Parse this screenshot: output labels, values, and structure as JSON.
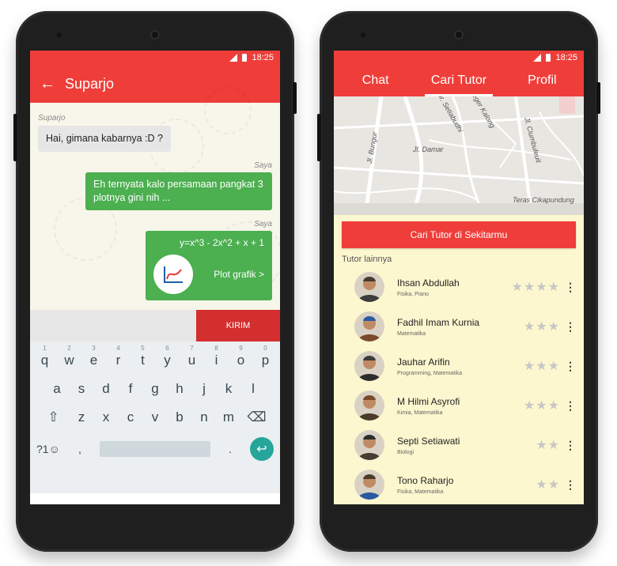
{
  "status": {
    "time": "18:25"
  },
  "chat": {
    "contact_name": "Suparjo",
    "back_icon": "arrow-left-icon",
    "messages": [
      {
        "sender": "Suparjo",
        "text": "Hai, gimana kabarnya :D ?",
        "side": "in"
      },
      {
        "sender": "Saya",
        "text": "Eh ternyata kalo persamaan pangkat 3 plotnya gini nih ...",
        "side": "out"
      },
      {
        "sender": "Saya",
        "equation": "y=x^3 - 2x^2 + x + 1",
        "action": "Plot grafik >",
        "side": "out"
      }
    ],
    "send_label": "KIRIM"
  },
  "keyboard": {
    "row1": [
      "q",
      "w",
      "e",
      "r",
      "t",
      "y",
      "u",
      "i",
      "o",
      "p"
    ],
    "row1_nums": [
      "1",
      "2",
      "3",
      "4",
      "5",
      "6",
      "7",
      "8",
      "9",
      "0"
    ],
    "row2": [
      "a",
      "s",
      "d",
      "f",
      "g",
      "h",
      "j",
      "k",
      "l"
    ],
    "row3": [
      "z",
      "x",
      "c",
      "v",
      "b",
      "n",
      "m"
    ],
    "symbols_label": "?1☺",
    "comma": ",",
    "period": "."
  },
  "tutor_app": {
    "tabs": [
      "Chat",
      "Cari Tutor",
      "Profil"
    ],
    "active_tab": 1,
    "map_labels": [
      "Jl. Dr. Setiabudhi",
      "Jl. Damar",
      "Jl. Bungur",
      "Jl. Ciumbuleuit",
      "Teras Cikapundung",
      "Geger Kalong"
    ],
    "find_button": "Cari Tutor di Sekitarmu",
    "others_label": "Tutor lainnya",
    "tutors": [
      {
        "name": "Ihsan Abdullah",
        "subjects": "Fisika, Piano",
        "rating": 4
      },
      {
        "name": "Fadhil Imam Kurnia",
        "subjects": "Matematika",
        "rating": 3
      },
      {
        "name": "Jauhar Arifin",
        "subjects": "Programming, Matematika",
        "rating": 3
      },
      {
        "name": "M Hilmi Asyrofi",
        "subjects": "Kimia, Matematika",
        "rating": 3
      },
      {
        "name": "Septi Setiawati",
        "subjects": "Biologi",
        "rating": 2
      },
      {
        "name": "Tono Raharjo",
        "subjects": "Fisika, Matematika",
        "rating": 2
      }
    ]
  },
  "colors": {
    "primary": "#ef3e3a",
    "accent_green": "#4caf50",
    "send_red": "#d32f2f",
    "tutor_bg": "#fdf7cf"
  }
}
